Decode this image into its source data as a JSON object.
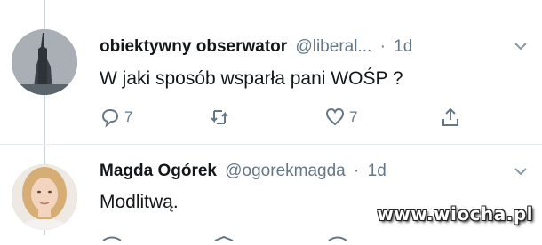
{
  "tweet1": {
    "display_name": "obiektywny obserwator",
    "handle": "@liberal...",
    "separator": "·",
    "time": "1d",
    "text": "W jaki sposób wsparła pani WOŚP ?",
    "actions": {
      "reply_count": "7",
      "retweet_count": "",
      "like_count": "7"
    },
    "icons": {
      "reply": "reply-icon",
      "retweet": "retweet-icon",
      "like": "heart-icon",
      "share": "share-icon",
      "menu": "chevron-down-icon"
    }
  },
  "tweet2": {
    "display_name": "Magda Ogórek",
    "handle": "@ogorekmagda",
    "separator": "·",
    "time": "1d",
    "text": "Modlitwą.",
    "icons": {
      "menu": "chevron-down-icon"
    }
  },
  "watermark": "www.wiocha.pl",
  "colors": {
    "text": "#14171a",
    "muted": "#657786",
    "thread_line": "#ccd6dd"
  }
}
